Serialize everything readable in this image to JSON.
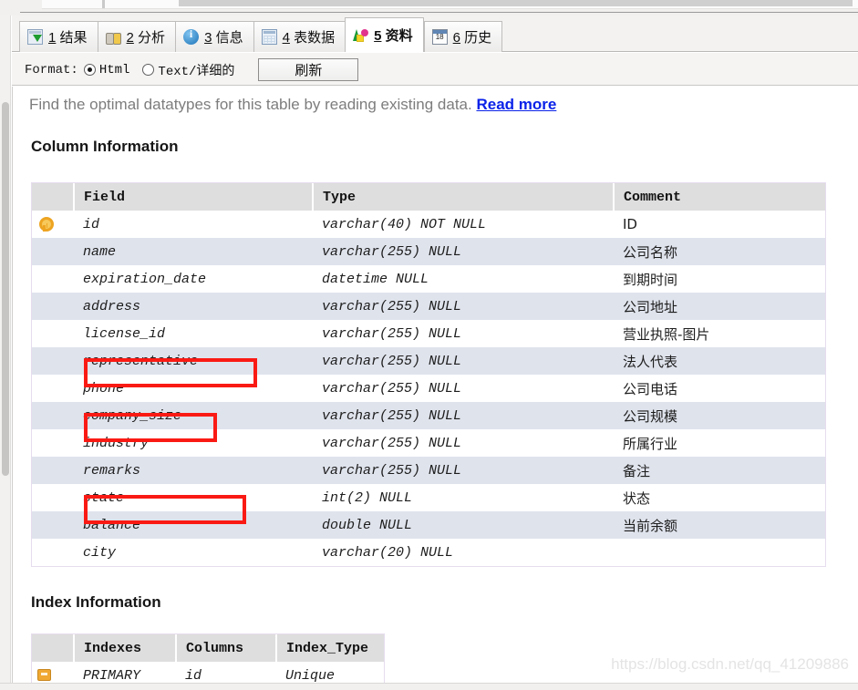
{
  "window": {
    "watermark": "https://blog.csdn.net/qq_41209886"
  },
  "tabs": [
    {
      "num": "1",
      "label": "结果",
      "icon": "results-grid-icon"
    },
    {
      "num": "2",
      "label": "分析",
      "icon": "binoculars-icon"
    },
    {
      "num": "3",
      "label": "信息",
      "icon": "info-circle-icon"
    },
    {
      "num": "4",
      "label": "表数据",
      "icon": "table-grid-icon"
    },
    {
      "num": "5",
      "label": "资料",
      "icon": "colored-shapes-icon"
    },
    {
      "num": "6",
      "label": "历史",
      "icon": "calendar-icon"
    }
  ],
  "active_tab_index": 4,
  "toolbar": {
    "format_label": "Format:",
    "option_html": "Html",
    "option_text": "Text/详细的",
    "selected_format": "Html",
    "refresh_label": "刷新"
  },
  "hint": {
    "text": "Find the optimal datatypes for this table by reading existing data.",
    "link_label": "Read more"
  },
  "column_information": {
    "title": "Column Information",
    "headers": {
      "icon": "",
      "field": "Field",
      "type": "Type",
      "comment": "Comment"
    },
    "rows": [
      {
        "icon": "primary-key-icon",
        "field": "id",
        "type": "varchar(40) NOT NULL",
        "comment": "ID",
        "highlighted": false
      },
      {
        "icon": "",
        "field": "name",
        "type": "varchar(255) NULL",
        "comment": "公司名称",
        "highlighted": false
      },
      {
        "icon": "",
        "field": "expiration_date",
        "type": "datetime NULL",
        "comment": "到期时间",
        "highlighted": true
      },
      {
        "icon": "",
        "field": "address",
        "type": "varchar(255) NULL",
        "comment": "公司地址",
        "highlighted": false
      },
      {
        "icon": "",
        "field": "license_id",
        "type": "varchar(255) NULL",
        "comment": "营业执照-图片",
        "highlighted": true
      },
      {
        "icon": "",
        "field": "representative",
        "type": "varchar(255) NULL",
        "comment": "法人代表",
        "highlighted": false
      },
      {
        "icon": "",
        "field": "phone",
        "type": "varchar(255) NULL",
        "comment": "公司电话",
        "highlighted": false
      },
      {
        "icon": "",
        "field": "company_size",
        "type": "varchar(255) NULL",
        "comment": "公司规模",
        "highlighted": true
      },
      {
        "icon": "",
        "field": "industry",
        "type": "varchar(255) NULL",
        "comment": "所属行业",
        "highlighted": false
      },
      {
        "icon": "",
        "field": "remarks",
        "type": "varchar(255) NULL",
        "comment": "备注",
        "highlighted": false
      },
      {
        "icon": "",
        "field": "state",
        "type": "int(2) NULL",
        "comment": "状态",
        "highlighted": false
      },
      {
        "icon": "",
        "field": "balance",
        "type": "double NULL",
        "comment": "当前余额",
        "highlighted": false
      },
      {
        "icon": "",
        "field": "city",
        "type": "varchar(20) NULL",
        "comment": "",
        "highlighted": false
      }
    ]
  },
  "index_information": {
    "title": "Index Information",
    "headers": {
      "icon": "",
      "indexes": "Indexes",
      "columns": "Columns",
      "index_type": "Index_Type"
    },
    "rows": [
      {
        "icon": "index-key-icon",
        "indexes": "PRIMARY",
        "columns": "id",
        "index_type": "Unique"
      }
    ]
  },
  "colors": {
    "annotation_red": "#fa1a14",
    "link_blue": "#0a22e8",
    "row_stripe": "#dfe3ec",
    "table_header": "#dedede",
    "table_border": "#e6dcee"
  }
}
